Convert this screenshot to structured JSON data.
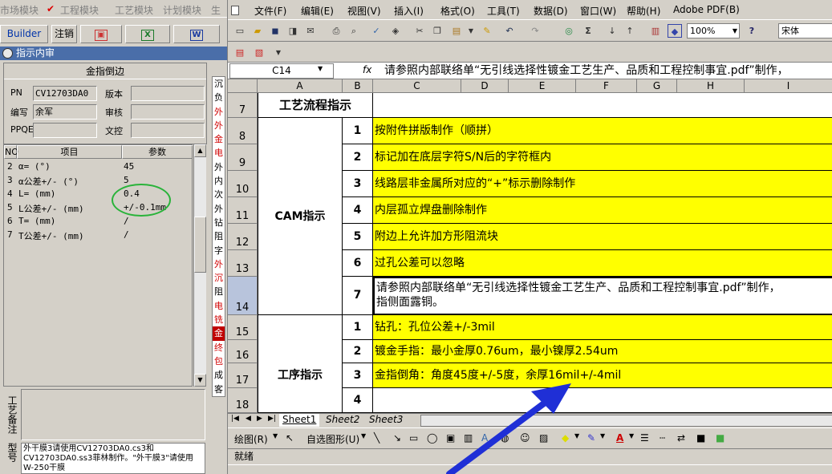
{
  "left_app": {
    "menu": [
      "市场模块",
      "工程模块",
      "工艺模块",
      "计划模块",
      "生"
    ],
    "toolbar": {
      "builder": "Builder",
      "logout": "注销",
      "icon1": "▣",
      "icon2": "X",
      "icon3": "W"
    },
    "title": "指示内审",
    "panel": {
      "caption": "金指倒边",
      "fields": [
        {
          "label": "PN",
          "value": "CV12703DA0"
        },
        {
          "label": "版本",
          "value": ""
        },
        {
          "label": "编写",
          "value": "余军"
        },
        {
          "label": "审核",
          "value": ""
        },
        {
          "label": "PPQE",
          "value": ""
        },
        {
          "label": "文控",
          "value": ""
        }
      ]
    },
    "grid": {
      "headers": [
        "NO",
        "项目",
        "参数"
      ],
      "rows": [
        {
          "no": "2",
          "item": "α= (°)",
          "param": "45"
        },
        {
          "no": "3",
          "item": "α公差+/- (°)",
          "param": "5"
        },
        {
          "no": "4",
          "item": "L= (mm)",
          "param": "0.4"
        },
        {
          "no": "5",
          "item": "L公差+/- (mm)",
          "param": "+/-0.1mm"
        },
        {
          "no": "6",
          "item": "T= (mm)",
          "param": "/"
        },
        {
          "no": "7",
          "item": "T公差+/- (mm)",
          "param": "/"
        }
      ]
    },
    "remark_label": "工艺备注",
    "note_label": "型号",
    "note_text": "外干膜3请使用CV12703DA0.cs3和CV12703DA0.ss3菲林制作。\"外干膜3\"请使用W-250干膜",
    "red_chars": [
      "沉",
      "负",
      "外",
      "外",
      "金",
      "电",
      "外",
      "内",
      "次",
      "外",
      "钻",
      "阻",
      "字",
      "外",
      "沉",
      "阻",
      "电",
      "铣",
      "金",
      "终",
      "包",
      "成",
      "客",
      "特"
    ]
  },
  "excel": {
    "menu": [
      "文件(F)",
      "编辑(E)",
      "视图(V)",
      "插入(I)",
      "格式(O)",
      "工具(T)",
      "数据(D)",
      "窗口(W)",
      "帮助(H)",
      "Adobe PDF(B)"
    ],
    "zoom": "100%",
    "font": "宋体",
    "namebox": "C14",
    "fx": "fx",
    "formula": "请参照内部联络单“无引线选择性镀金工艺生产、品质和工程控制事宜.pdf”制作，",
    "columns": [
      "A",
      "B",
      "C",
      "D",
      "E",
      "F",
      "G",
      "H",
      "I"
    ],
    "rows": [
      {
        "num": "7",
        "a": "工艺流程指示",
        "b": "",
        "c": ""
      },
      {
        "num": "8",
        "a": "",
        "b": "1",
        "c": "按附件拼版制作（顺拼）"
      },
      {
        "num": "9",
        "a": "",
        "b": "2",
        "c": "标记加在底层字符S/N后的字符框内"
      },
      {
        "num": "10",
        "a": "",
        "b": "3",
        "c": "线路层非金属所对应的“+”标示删除制作"
      },
      {
        "num": "11",
        "a": "CAM指示",
        "b": "4",
        "c": "内层孤立焊盘删除制作"
      },
      {
        "num": "12",
        "a": "",
        "b": "5",
        "c": "附边上允许加方形阻流块"
      },
      {
        "num": "13",
        "a": "",
        "b": "6",
        "c": "过孔公差可以忽略"
      },
      {
        "num": "14",
        "a": "",
        "b": "7",
        "c": "请参照内部联络单“无引线选择性镀金工艺生产、品质和工程控制事宜.pdf”制作，",
        "c2": "指侧面露铜。"
      },
      {
        "num": "15",
        "a": "",
        "b": "1",
        "c": "钻孔：孔位公差+/-3mil"
      },
      {
        "num": "16",
        "a": "",
        "b": "2",
        "c": "镀金手指：最小金厚0.76um，最小镍厚2.54um"
      },
      {
        "num": "17",
        "a": "工序指示",
        "b": "3",
        "c": "金指倒角：角度45度+/-5度，余厚16mil+/-4mil"
      },
      {
        "num": "18",
        "a": "",
        "b": "4",
        "c": ""
      }
    ],
    "sheets": [
      "Sheet1",
      "Sheet2",
      "Sheet3"
    ],
    "draw_label": "绘图(R)",
    "autoshape": "自选图形(U)",
    "status": "就绪",
    "colors": {
      "highlight": "#ffff00",
      "arrow": "#1f2fd6",
      "circle": "#29b33a"
    }
  }
}
